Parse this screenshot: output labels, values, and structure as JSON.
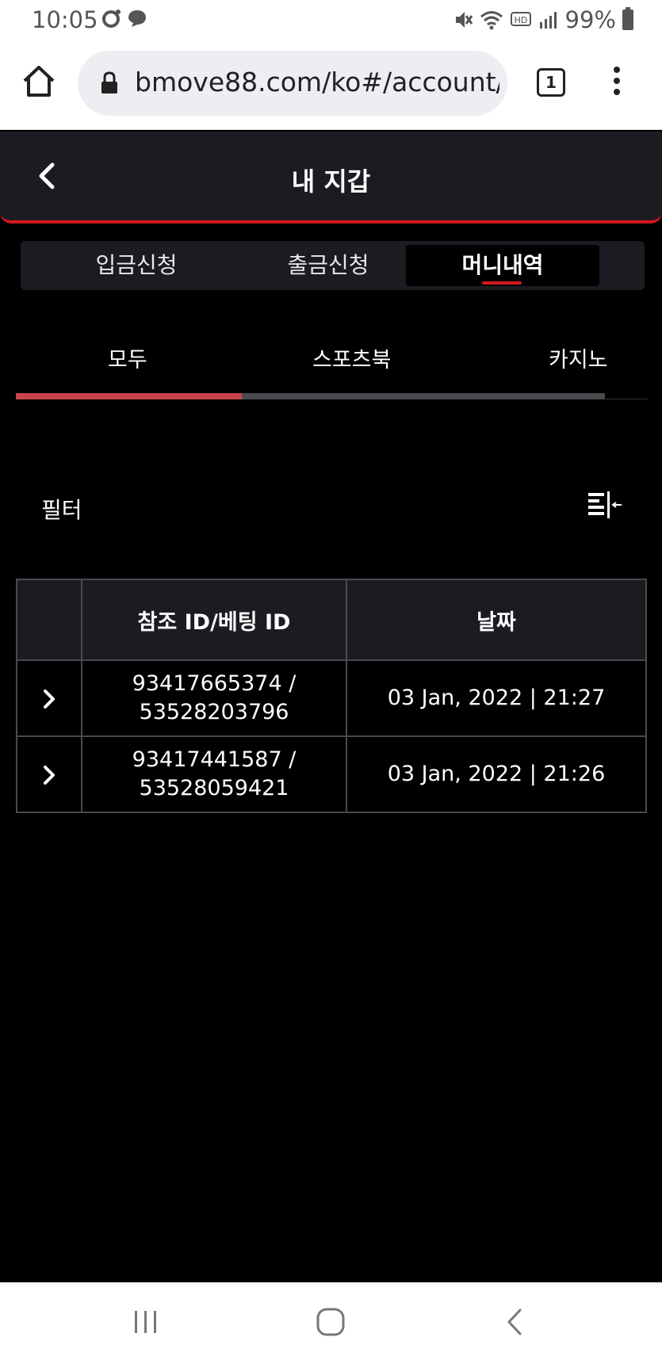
{
  "status_bar": {
    "time": "10:05",
    "battery": "99%",
    "icons": [
      "notification-circle-icon",
      "chat-bubble-icon",
      "mute-icon",
      "wifi-icon",
      "hd-voice-icon",
      "signal-icon",
      "battery-icon"
    ]
  },
  "browser": {
    "url": "bmove88.com/ko#/account/",
    "tab_count": "1"
  },
  "header": {
    "title": "내 지갑"
  },
  "main_tabs": [
    {
      "label": "입금신청",
      "active": false
    },
    {
      "label": "출금신청",
      "active": false
    },
    {
      "label": "머니내역",
      "active": true
    }
  ],
  "sub_tabs": [
    {
      "label": "모두",
      "active": true
    },
    {
      "label": "스포츠북",
      "active": false
    },
    {
      "label": "카지노",
      "active": false
    }
  ],
  "filter": {
    "label": "필터"
  },
  "table": {
    "headers": [
      "",
      "참조 ID/베팅 ID",
      "날짜"
    ],
    "rows": [
      {
        "ref_line1": "93417665374 /",
        "ref_line2": "53528203796",
        "date": "03 Jan, 2022 | 21:27"
      },
      {
        "ref_line1": "93417441587 /",
        "ref_line2": "53528059421",
        "date": "03 Jan, 2022 | 21:26"
      }
    ]
  },
  "colors": {
    "accent": "#d4161d",
    "header_bg": "#1b1c21",
    "page_bg": "#000000",
    "sub_tab_active": "#c9434a"
  }
}
